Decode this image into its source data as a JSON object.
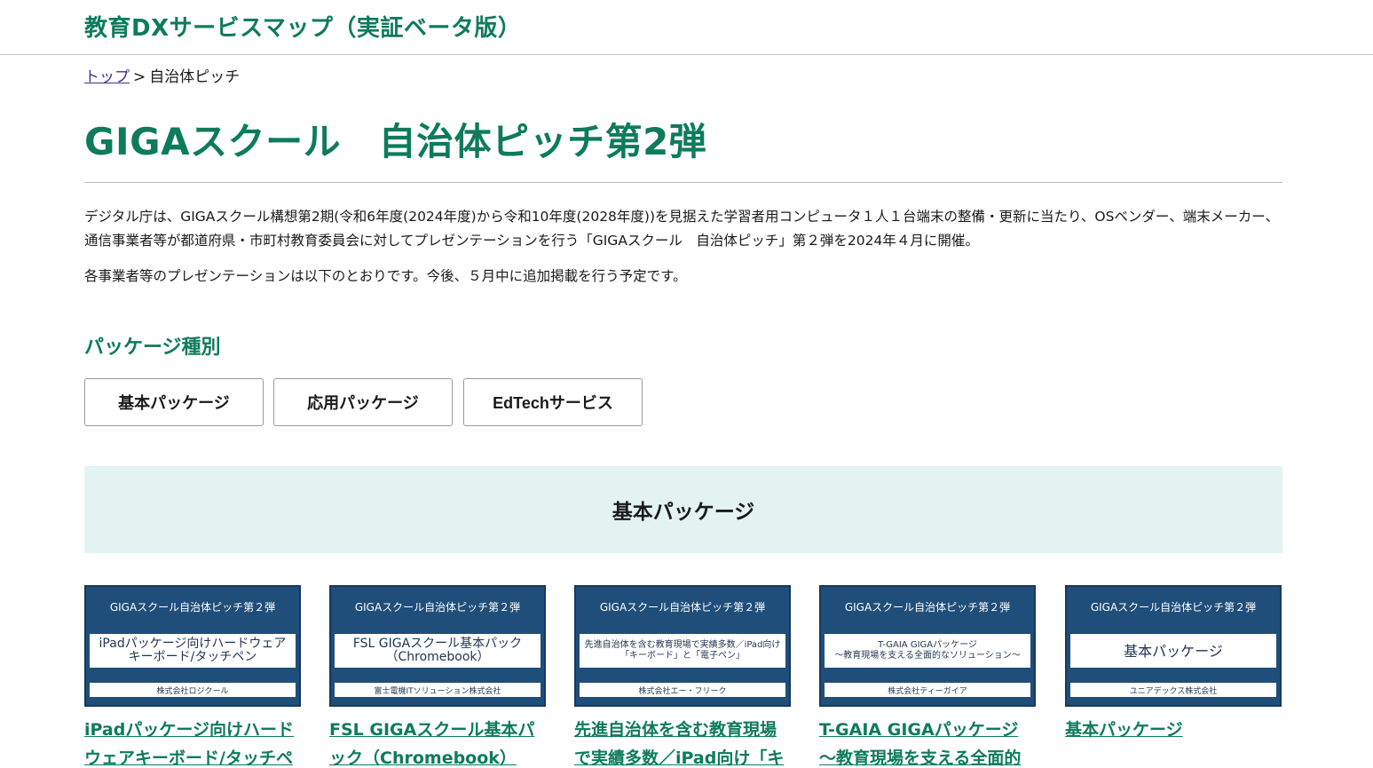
{
  "header": {
    "site_title": "教育DXサービスマップ（実証ベータ版）"
  },
  "breadcrumb": {
    "home_label": "トップ",
    "separator": ">",
    "current": "自治体ピッチ"
  },
  "page": {
    "title": "GIGAスクール　自治体ピッチ第2弾",
    "intro": "デジタル庁は、GIGAスクール構想第2期(令和6年度(2024年度)から令和10年度(2028年度))を見据えた学習者用コンピュータ１人１台端末の整備・更新に当たり、OSベンダー、端末メーカー、通信事業者等が都道府県・市町村教育委員会に対してプレゼンテーションを行う「GIGAスクール　自治体ピッチ」第２弾を2024年４月に開催。",
    "intro2": "各事業者等のプレゼンテーションは以下のとおりです。今後、５月中に追加掲載を行う予定です。"
  },
  "package_filter": {
    "heading": "パッケージ種別",
    "buttons": [
      "基本パッケージ",
      "応用パッケージ",
      "EdTechサービス"
    ]
  },
  "category": {
    "title": "基本パッケージ"
  },
  "cards": [
    {
      "thumb_header": "GIGAスクール自治体ピッチ第２弾",
      "thumb_title": "iPadパッケージ向けハードウェア\nキーボード/タッチペン",
      "thumb_company": "株式会社ロジクール",
      "link": "iPadパッケージ向けハードウェアキーボード/タッチペン"
    },
    {
      "thumb_header": "GIGAスクール自治体ピッチ第２弾",
      "thumb_title": "FSL GIGAスクール基本パック\n（Chromebook）",
      "thumb_company": "富士電機ITソリューション株式会社",
      "link": "FSL GIGAスクール基本パック（Chromebook）"
    },
    {
      "thumb_header": "GIGAスクール自治体ピッチ第２弾",
      "thumb_title": "先進自治体を含む教育現場で実績多数／iPad向け\n「キーボード」と「電子ペン」",
      "thumb_company": "株式会社エー・フリーク",
      "link": "先進自治体を含む教育現場で実績多数／iPad向け「キーボ"
    },
    {
      "thumb_header": "GIGAスクール自治体ピッチ第２弾",
      "thumb_title": "T-GAIA GIGAパッケージ\n〜教育現場を支える全面的なソリューション〜",
      "thumb_company": "株式会社ティーガイア",
      "link": "T-GAIA GIGAパッケージ ～教育現場を支える全面的なソリ"
    },
    {
      "thumb_header": "GIGAスクール自治体ピッチ第２弾",
      "thumb_title": "基本パッケージ",
      "thumb_company": "ユニアデックス株式会社",
      "link": "基本パッケージ"
    }
  ],
  "colors": {
    "brand_green": "#0e7b5c",
    "thumb_navy": "#1f4e7a",
    "banner_bg": "#e3f3f1",
    "visited_link": "#4a2f86"
  }
}
